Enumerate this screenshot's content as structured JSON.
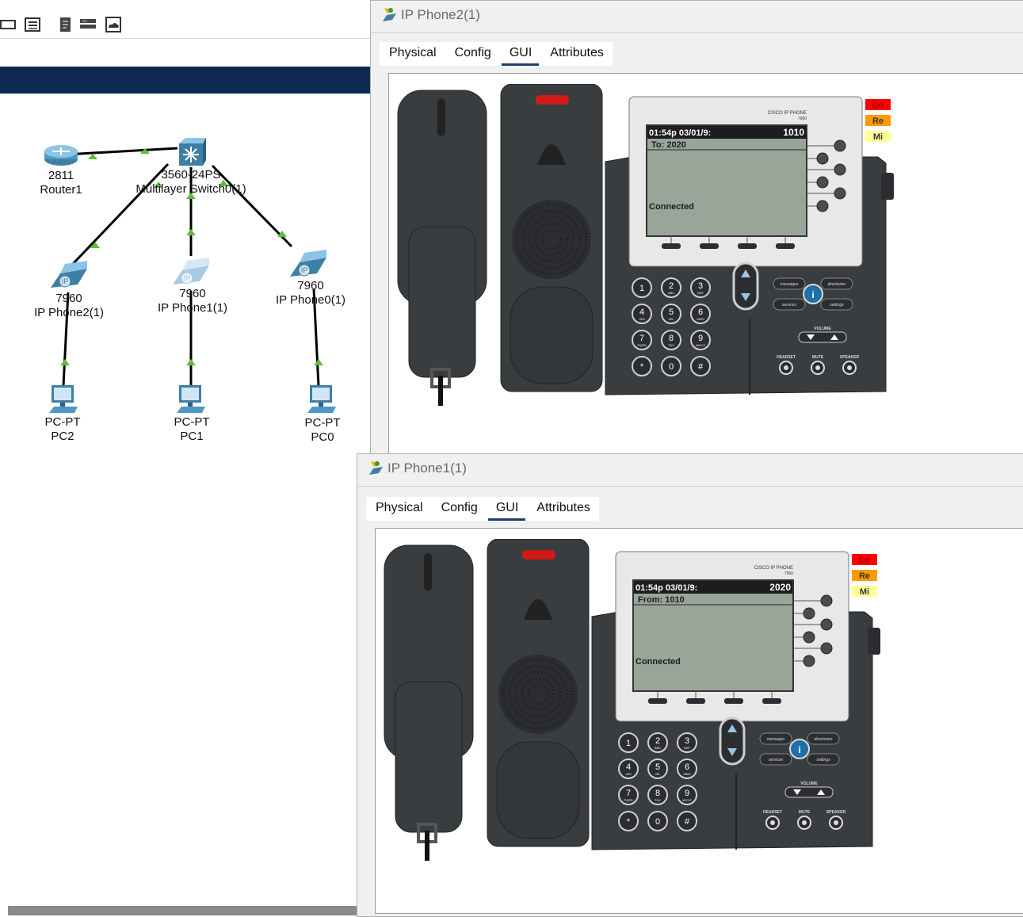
{
  "topology": {
    "devices": [
      {
        "id": "router",
        "model": "2811",
        "name": "Router1"
      },
      {
        "id": "switch",
        "model": "3560-24PS",
        "name": "Multilayer Switch0(1)"
      },
      {
        "id": "phone2",
        "model": "7960",
        "name": "IP Phone2(1)"
      },
      {
        "id": "phone1",
        "model": "7960",
        "name": "IP Phone1(1)"
      },
      {
        "id": "phone0",
        "model": "7960",
        "name": "IP Phone0(1)"
      },
      {
        "id": "pc2",
        "model": "PC-PT",
        "name": "PC2"
      },
      {
        "id": "pc1",
        "model": "PC-PT",
        "name": "PC1"
      },
      {
        "id": "pc0",
        "model": "PC-PT",
        "name": "PC0"
      }
    ],
    "link_status_color": "#5bbf3a",
    "ip_badge": "IP"
  },
  "windows": [
    {
      "title": "IP Phone2(1)",
      "tabs": [
        "Physical",
        "Config",
        "GUI",
        "Attributes"
      ],
      "active_tab": "GUI",
      "phone": {
        "brand": "CISCO IP PHONE",
        "model": "7960",
        "time": "01:54p 03/01/9:",
        "ext": "1010",
        "peer_line": "To: 2020",
        "status": "Connected",
        "lamps": [
          "Do",
          "Re",
          "Mi"
        ],
        "keys": [
          [
            "1",
            ""
          ],
          [
            "2",
            "ABC"
          ],
          [
            "3",
            "DEF"
          ],
          [
            "4",
            "GHI"
          ],
          [
            "5",
            "JKL"
          ],
          [
            "6",
            "MNO"
          ],
          [
            "7",
            "PQRS"
          ],
          [
            "8",
            "TUV"
          ],
          [
            "9",
            "WXYZ"
          ],
          [
            "*",
            ""
          ],
          [
            "0",
            ""
          ],
          [
            "#",
            ""
          ]
        ],
        "soft_labels": {
          "messages": "messages",
          "directories": "directories",
          "services": "services",
          "settings": "settings",
          "info": "i",
          "volume": "VOLUME",
          "headset": "HEADSET",
          "mute": "MUTE",
          "speaker": "SPEAKER"
        }
      }
    },
    {
      "title": "IP Phone1(1)",
      "tabs": [
        "Physical",
        "Config",
        "GUI",
        "Attributes"
      ],
      "active_tab": "GUI",
      "phone": {
        "brand": "CISCO IP PHONE",
        "model": "7960",
        "time": "01:54p 03/01/9:",
        "ext": "2020",
        "peer_line": "From: 1010",
        "status": "Connected",
        "lamps": [
          "Do",
          "Re",
          "Mi"
        ],
        "keys": [
          [
            "1",
            ""
          ],
          [
            "2",
            "ABC"
          ],
          [
            "3",
            "DEF"
          ],
          [
            "4",
            "GHI"
          ],
          [
            "5",
            "JKL"
          ],
          [
            "6",
            "MNO"
          ],
          [
            "7",
            "PQRS"
          ],
          [
            "8",
            "TUV"
          ],
          [
            "9",
            "WXYZ"
          ],
          [
            "*",
            ""
          ],
          [
            "0",
            ""
          ],
          [
            "#",
            ""
          ]
        ],
        "soft_labels": {
          "messages": "messages",
          "directories": "directories",
          "services": "services",
          "settings": "settings",
          "info": "i",
          "volume": "VOLUME",
          "headset": "HEADSET",
          "mute": "MUTE",
          "speaker": "SPEAKER"
        }
      }
    }
  ],
  "colors": {
    "navy": "#0f2a52",
    "lamp_red": "#ff0000",
    "lamp_orange": "#ff9900",
    "lamp_yellow": "#ffff99",
    "lcd": "#9aa59a",
    "phone_body": "#3a3d40"
  }
}
